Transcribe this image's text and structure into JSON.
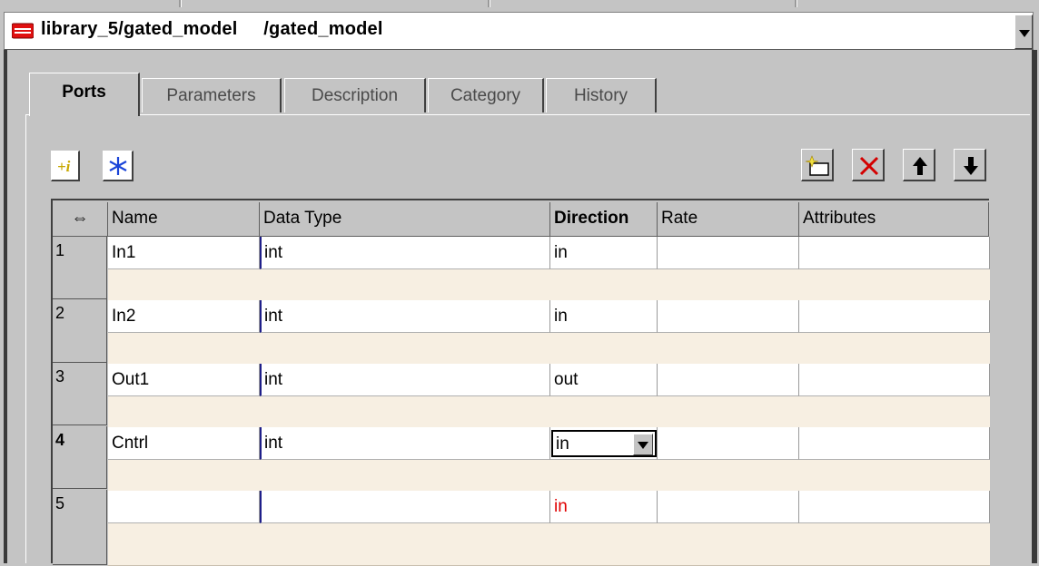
{
  "window": {
    "title": "library_5/gated_model     /gated_model"
  },
  "tabs": [
    {
      "label": "Ports",
      "active": true
    },
    {
      "label": "Parameters",
      "active": false
    },
    {
      "label": "Description",
      "active": false
    },
    {
      "label": "Category",
      "active": false
    },
    {
      "label": "History",
      "active": false
    }
  ],
  "toolbar": {
    "left_icons": [
      "insert-info-icon",
      "freeze-icon"
    ],
    "right_icons": [
      "new-row-icon",
      "delete-icon",
      "move-up-icon",
      "move-down-icon"
    ]
  },
  "grid": {
    "resize_glyph": "⇔",
    "columns": [
      "Name",
      "Data Type",
      "Direction",
      "Rate",
      "Attributes"
    ],
    "rows": [
      {
        "num": "1",
        "name": "In1",
        "type": "int",
        "direction": "in",
        "rate": "",
        "attributes": ""
      },
      {
        "num": "2",
        "name": "In2",
        "type": "int",
        "direction": "in",
        "rate": "",
        "attributes": ""
      },
      {
        "num": "3",
        "name": "Out1",
        "type": "int",
        "direction": "out",
        "rate": "",
        "attributes": ""
      },
      {
        "num": "4",
        "name": "Cntrl",
        "type": "int",
        "direction": "in",
        "rate": "",
        "attributes": ""
      },
      {
        "num": "5",
        "name": "",
        "type": "",
        "direction": "in",
        "rate": "",
        "attributes": ""
      }
    ]
  },
  "colors": {
    "chrome": "#c4c4c4",
    "row_desc": "#f7efe2",
    "default_direction": "#e00000",
    "type_marker": "#1f1f8a"
  }
}
